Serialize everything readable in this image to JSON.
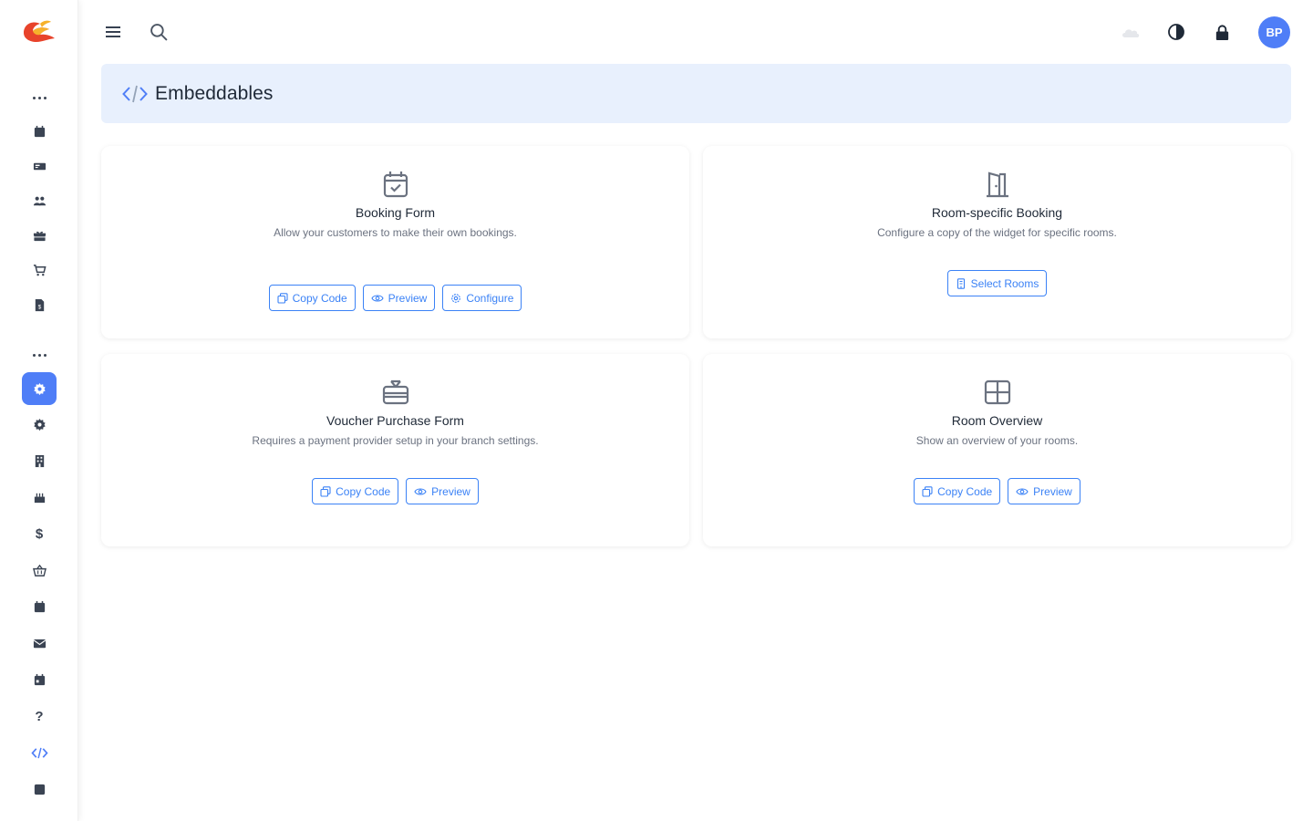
{
  "header": {
    "title": "Embeddables"
  },
  "topbar": {
    "avatar_initials": "BP"
  },
  "sidebar": {
    "help_label": "?",
    "dollar_label": "$"
  },
  "cards": [
    {
      "title": "Booking Form",
      "description": "Allow your customers to make their own bookings.",
      "buttons": [
        "Copy Code",
        "Preview",
        "Configure"
      ]
    },
    {
      "title": "Room-specific Booking",
      "description": "Configure a copy of the widget for specific rooms.",
      "buttons": [
        "Select Rooms"
      ]
    },
    {
      "title": "Voucher Purchase Form",
      "description": "Requires a payment provider setup in your branch settings.",
      "buttons": [
        "Copy Code",
        "Preview"
      ]
    },
    {
      "title": "Room Overview",
      "description": "Show an overview of your rooms.",
      "buttons": [
        "Copy Code",
        "Preview"
      ]
    }
  ],
  "colors": {
    "accent": "#4f7ef7",
    "header_bg": "#e8f0fd",
    "button": "#3b82f6"
  }
}
